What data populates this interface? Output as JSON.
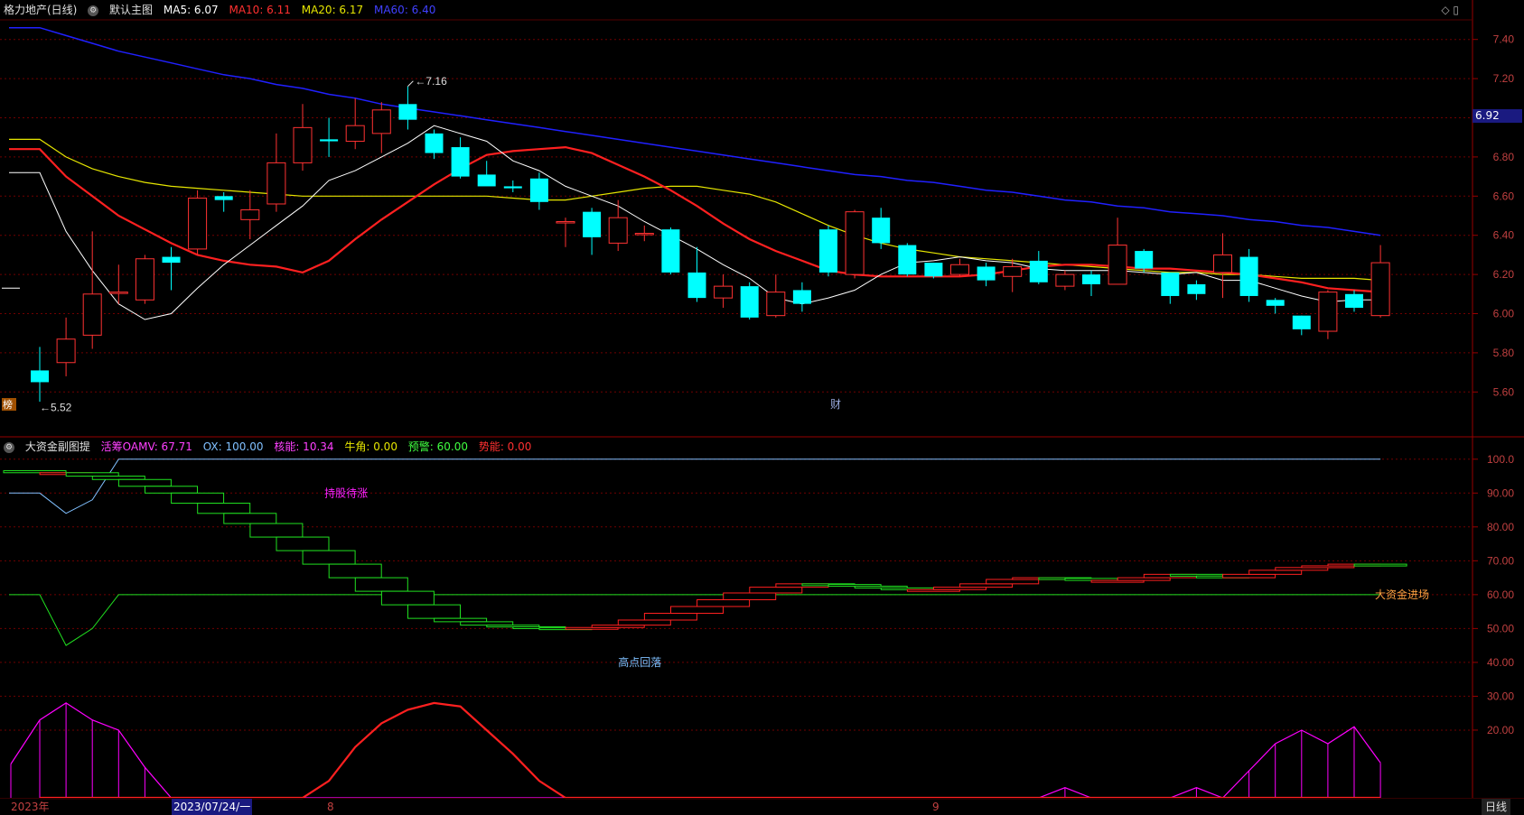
{
  "main_header": {
    "stock_title": "格力地产(日线)",
    "chart_name": "默认主图",
    "ma5": "MA5: 6.07",
    "ma10": "MA10: 6.11",
    "ma20": "MA20: 6.17",
    "ma60": "MA60: 6.40"
  },
  "sub_header": {
    "title": "大资金副图提",
    "oamv": "活筹OAMV: 67.71",
    "ox": "OX: 100.00",
    "hn": "核能: 10.34",
    "nj": "牛角: 0.00",
    "yj": "预警: 60.00",
    "sn": "势能: 0.00"
  },
  "colors": {
    "background": "#000000",
    "up": "#ff3232",
    "down": "#00ffff",
    "ma5": "#ffffff",
    "ma10": "#ff2020",
    "ma20": "#e6e600",
    "ma60": "#2020ff",
    "grid": "#700000",
    "axis_text": "#c04040",
    "oamv_up": "#ff2020",
    "oamv_down": "#20e020",
    "energy": "#ff00ff"
  },
  "icons": [
    "settings-icon",
    "diamond-icon",
    "window-icon"
  ],
  "price_badge": "6.92",
  "bottom_bar": {
    "year": "2023年",
    "cursor_date": "2023/07/24/一",
    "month_8": "8",
    "month_9": "9",
    "period": "日线"
  },
  "chart_data": [
    {
      "type": "candlestick",
      "name": "price",
      "ylim": [
        5.5,
        7.5
      ],
      "yticks": [
        "7.40",
        "7.20",
        "7.00",
        "6.80",
        "6.60",
        "6.40",
        "6.20",
        "6.00",
        "5.80",
        "5.60"
      ],
      "ohlc": [
        [
          5.71,
          5.83,
          5.55,
          5.65
        ],
        [
          5.75,
          5.98,
          5.68,
          5.87
        ],
        [
          5.89,
          6.42,
          5.82,
          6.1
        ],
        [
          6.11,
          6.25,
          6.05,
          6.11
        ],
        [
          6.07,
          6.3,
          6.05,
          6.28
        ],
        [
          6.29,
          6.34,
          6.12,
          6.26
        ],
        [
          6.33,
          6.63,
          6.3,
          6.59
        ],
        [
          6.6,
          6.62,
          6.52,
          6.58
        ],
        [
          6.48,
          6.63,
          6.38,
          6.53
        ],
        [
          6.56,
          6.92,
          6.52,
          6.77
        ],
        [
          6.77,
          7.07,
          6.73,
          6.95
        ],
        [
          6.89,
          7.0,
          6.8,
          6.88
        ],
        [
          6.88,
          7.1,
          6.84,
          6.96
        ],
        [
          6.92,
          7.08,
          6.82,
          7.04
        ],
        [
          7.07,
          7.16,
          6.94,
          6.99
        ],
        [
          6.92,
          6.94,
          6.79,
          6.82
        ],
        [
          6.85,
          6.9,
          6.69,
          6.7
        ],
        [
          6.71,
          6.78,
          6.66,
          6.65
        ],
        [
          6.65,
          6.68,
          6.62,
          6.64
        ],
        [
          6.69,
          6.72,
          6.53,
          6.57
        ],
        [
          6.47,
          6.49,
          6.34,
          6.47
        ],
        [
          6.52,
          6.54,
          6.3,
          6.39
        ],
        [
          6.36,
          6.58,
          6.32,
          6.49
        ],
        [
          6.41,
          6.45,
          6.37,
          6.41
        ],
        [
          6.43,
          6.44,
          6.2,
          6.21
        ],
        [
          6.21,
          6.34,
          6.06,
          6.08
        ],
        [
          6.08,
          6.2,
          6.03,
          6.14
        ],
        [
          6.14,
          6.16,
          5.97,
          5.98
        ],
        [
          5.99,
          6.2,
          5.98,
          6.11
        ],
        [
          6.12,
          6.16,
          6.01,
          6.05
        ],
        [
          6.43,
          6.45,
          6.19,
          6.21
        ],
        [
          6.2,
          6.53,
          6.18,
          6.52
        ],
        [
          6.49,
          6.54,
          6.33,
          6.36
        ],
        [
          6.35,
          6.36,
          6.19,
          6.2
        ],
        [
          6.26,
          6.26,
          6.18,
          6.19
        ],
        [
          6.2,
          6.28,
          6.19,
          6.25
        ],
        [
          6.24,
          6.26,
          6.14,
          6.17
        ],
        [
          6.19,
          6.28,
          6.11,
          6.24
        ],
        [
          6.27,
          6.32,
          6.15,
          6.16
        ],
        [
          6.14,
          6.22,
          6.12,
          6.2
        ],
        [
          6.2,
          6.22,
          6.09,
          6.15
        ],
        [
          6.15,
          6.49,
          6.15,
          6.35
        ],
        [
          6.32,
          6.33,
          6.21,
          6.23
        ],
        [
          6.21,
          6.21,
          6.05,
          6.09
        ],
        [
          6.15,
          6.17,
          6.07,
          6.1
        ],
        [
          6.21,
          6.41,
          6.08,
          6.3
        ],
        [
          6.29,
          6.33,
          6.06,
          6.09
        ],
        [
          6.07,
          6.08,
          6.0,
          6.04
        ],
        [
          5.99,
          5.99,
          5.89,
          5.92
        ],
        [
          5.91,
          6.12,
          5.87,
          6.11
        ],
        [
          6.1,
          6.12,
          6.01,
          6.03
        ],
        [
          5.99,
          6.35,
          5.98,
          6.26
        ]
      ],
      "ma5": [
        6.72,
        6.42,
        6.22,
        6.05,
        5.97,
        6.0,
        6.13,
        6.25,
        6.35,
        6.45,
        6.55,
        6.68,
        6.73,
        6.8,
        6.87,
        6.96,
        6.92,
        6.88,
        6.78,
        6.73,
        6.65,
        6.6,
        6.55,
        6.47,
        6.4,
        6.33,
        6.25,
        6.18,
        6.08,
        6.05,
        6.08,
        6.12,
        6.2,
        6.26,
        6.27,
        6.29,
        6.27,
        6.26,
        6.23,
        6.22,
        6.22,
        6.22,
        6.21,
        6.2,
        6.21,
        6.17,
        6.17,
        6.13,
        6.09,
        6.06,
        6.07,
        6.07
      ],
      "ma10": [
        6.84,
        6.7,
        6.6,
        6.5,
        6.43,
        6.36,
        6.3,
        6.27,
        6.25,
        6.24,
        6.21,
        6.27,
        6.38,
        6.48,
        6.57,
        6.66,
        6.74,
        6.81,
        6.83,
        6.84,
        6.85,
        6.82,
        6.76,
        6.7,
        6.63,
        6.55,
        6.46,
        6.38,
        6.32,
        6.27,
        6.22,
        6.2,
        6.19,
        6.19,
        6.19,
        6.19,
        6.2,
        6.22,
        6.24,
        6.25,
        6.25,
        6.24,
        6.23,
        6.23,
        6.22,
        6.21,
        6.2,
        6.18,
        6.16,
        6.13,
        6.12,
        6.11
      ],
      "ma20": [
        6.89,
        6.8,
        6.74,
        6.7,
        6.67,
        6.65,
        6.64,
        6.63,
        6.62,
        6.61,
        6.6,
        6.6,
        6.6,
        6.6,
        6.6,
        6.6,
        6.6,
        6.6,
        6.59,
        6.58,
        6.58,
        6.6,
        6.62,
        6.64,
        6.65,
        6.65,
        6.63,
        6.61,
        6.57,
        6.51,
        6.45,
        6.4,
        6.36,
        6.33,
        6.31,
        6.29,
        6.28,
        6.27,
        6.26,
        6.25,
        6.24,
        6.23,
        6.22,
        6.21,
        6.21,
        6.2,
        6.2,
        6.19,
        6.18,
        6.18,
        6.18,
        6.17
      ],
      "ma60": [
        7.46,
        7.42,
        7.38,
        7.34,
        7.31,
        7.28,
        7.25,
        7.22,
        7.2,
        7.17,
        7.15,
        7.12,
        7.1,
        7.07,
        7.05,
        7.03,
        7.01,
        6.99,
        6.97,
        6.95,
        6.93,
        6.91,
        6.89,
        6.87,
        6.85,
        6.83,
        6.81,
        6.79,
        6.77,
        6.75,
        6.73,
        6.71,
        6.7,
        6.68,
        6.67,
        6.65,
        6.63,
        6.62,
        6.6,
        6.58,
        6.57,
        6.55,
        6.54,
        6.52,
        6.51,
        6.5,
        6.48,
        6.47,
        6.45,
        6.44,
        6.42,
        6.4
      ],
      "annotations": [
        {
          "label": "7.16",
          "bar": 14,
          "price": 7.16
        },
        {
          "label": "5.52",
          "bar": 0,
          "price": 5.52
        },
        {
          "label": "财",
          "bar": 30,
          "price": 5.52
        },
        {
          "label": "榜",
          "bar": 0,
          "price": 5.52
        }
      ]
    },
    {
      "type": "indicator",
      "name": "大资金副图提",
      "ylim": [
        0,
        105
      ],
      "yticks": [
        "100.0",
        "90.00",
        "80.00",
        "70.00",
        "60.00",
        "50.00",
        "40.00",
        "30.00",
        "20.00"
      ],
      "oamv": [
        96,
        96,
        95,
        94,
        92,
        90,
        87,
        84,
        81,
        77,
        73,
        69,
        65,
        61,
        57,
        53,
        52,
        51,
        50.5,
        50.2,
        50.1,
        50.3,
        51,
        52.5,
        54.5,
        56.5,
        58.5,
        60.5,
        62.2,
        63.2,
        63,
        62.5,
        62,
        61.5,
        61.5,
        62.2,
        63.2,
        64.5,
        65,
        64.8,
        64.2,
        64.2,
        65,
        66,
        65.5,
        65,
        66,
        67.2,
        68,
        68.5,
        69,
        68.5
      ],
      "ox": [
        90,
        84,
        88,
        100,
        100,
        100,
        100,
        100,
        100,
        100,
        100,
        100,
        100,
        100,
        100,
        100,
        100,
        100,
        100,
        100,
        100,
        100,
        100,
        100,
        100,
        100,
        100,
        100,
        100,
        100,
        100,
        100,
        100,
        100,
        100,
        100,
        100,
        100,
        100,
        100,
        100,
        100,
        100,
        100,
        100,
        100,
        100,
        100,
        100,
        100,
        100,
        100
      ],
      "warning": [
        60,
        45,
        50,
        60,
        60,
        60,
        60,
        60,
        60,
        60,
        60,
        60,
        60,
        60,
        60,
        60,
        60,
        60,
        60,
        60,
        60,
        60,
        60,
        60,
        60,
        60,
        60,
        60,
        60,
        60,
        60,
        60,
        60,
        60,
        60,
        60,
        60,
        60,
        60,
        60,
        60,
        60,
        60,
        60,
        60,
        60,
        60,
        60,
        60,
        60,
        60,
        60
      ],
      "energy": [
        10,
        23,
        28,
        23,
        20,
        9,
        0,
        0,
        0,
        0,
        0,
        0,
        0,
        0,
        0,
        0,
        0,
        0,
        0,
        0,
        0,
        0,
        0,
        0,
        0,
        0,
        0,
        0,
        0,
        0,
        0,
        0,
        0,
        0,
        0,
        0,
        0,
        0,
        0,
        0,
        3,
        0,
        0,
        0,
        0,
        3,
        0,
        8,
        16,
        20,
        16,
        21,
        10.34
      ],
      "momentum": [
        0,
        0,
        0,
        0,
        0,
        0,
        0,
        0,
        0,
        0,
        0,
        5,
        15,
        22,
        26,
        28,
        27,
        20,
        13,
        5,
        0,
        0,
        0,
        0,
        0,
        0,
        0,
        0,
        0,
        0,
        0,
        0,
        0,
        0,
        0,
        0,
        0,
        0,
        0,
        0,
        0,
        0,
        0,
        0,
        0,
        0,
        0,
        0,
        0,
        0,
        0,
        0
      ],
      "labels": [
        {
          "text": "持股待涨",
          "bar": 11,
          "value": 90
        },
        {
          "text": "高点回落",
          "bar": 22,
          "value": 40
        },
        {
          "text": "大资金进场",
          "bar": 52,
          "value": 60
        }
      ]
    }
  ]
}
